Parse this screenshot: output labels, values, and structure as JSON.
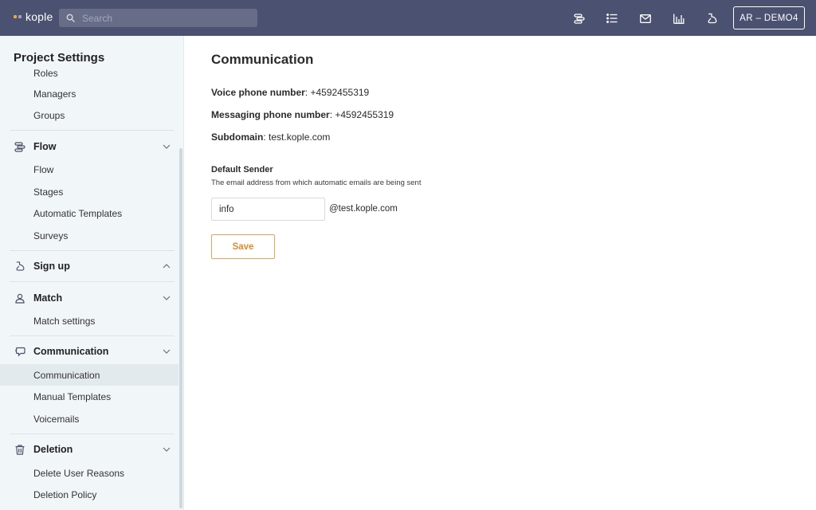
{
  "app": {
    "logo_text": "kople",
    "logo_colors": [
      "#f2a43a",
      "#9fa4c4"
    ],
    "brand_color": "#4b5170"
  },
  "topbar": {
    "search_placeholder": "Search",
    "icons": [
      "flow-icon",
      "list-icon",
      "mail-icon",
      "chart-icon",
      "signup-icon"
    ],
    "user_label": "AR – DEMO4"
  },
  "sidebar": {
    "title": "Project Settings",
    "top_items": [
      "Roles",
      "Managers",
      "Groups"
    ],
    "sections": [
      {
        "label": "Flow",
        "icon": "flow-icon",
        "expanded": true,
        "items": [
          "Flow",
          "Stages",
          "Automatic Templates",
          "Surveys"
        ]
      },
      {
        "label": "Sign up",
        "icon": "signup-icon",
        "expanded": false,
        "items": []
      },
      {
        "label": "Match",
        "icon": "match-icon",
        "expanded": true,
        "items": [
          "Match settings"
        ]
      },
      {
        "label": "Communication",
        "icon": "chat-icon",
        "expanded": true,
        "items": [
          "Communication",
          "Manual Templates",
          "Voicemails"
        ],
        "active_item": "Communication"
      },
      {
        "label": "Deletion",
        "icon": "trash-icon",
        "expanded": true,
        "items": [
          "Delete User Reasons",
          "Deletion Policy"
        ]
      }
    ]
  },
  "main": {
    "title": "Communication",
    "voice_label": "Voice phone number",
    "voice_value": "+4592455319",
    "messaging_label": "Messaging phone number",
    "messaging_value": "+4592455319",
    "subdomain_label": "Subdomain",
    "subdomain_value": "test.kople.com",
    "sender_heading": "Default Sender",
    "sender_description": "The email address from which automatic emails are being sent",
    "sender_value": "info",
    "sender_suffix": "@test.kople.com",
    "save_label": "Save",
    "accent_color": "#e08a2e"
  }
}
